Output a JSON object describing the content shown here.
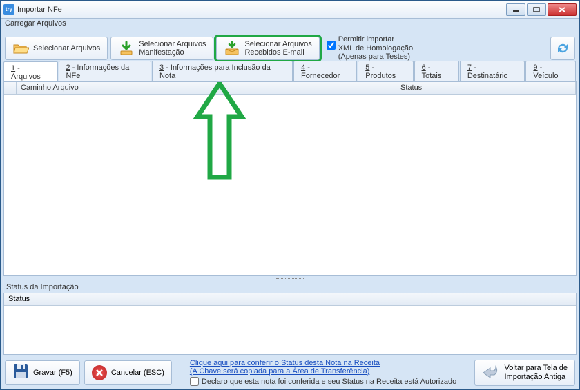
{
  "window": {
    "app_icon_text": "try",
    "title": "Importar NFe"
  },
  "menubar": {
    "item1": "Carregar Arquivos"
  },
  "toolbar": {
    "btn1": "Selecionar Arquivos",
    "btn2_line1": "Selecionar Arquivos",
    "btn2_line2": "Manifestação",
    "btn3_line1": "Selecionar Arquivos",
    "btn3_line2": "Recebidos E-mail",
    "permitir_line1": "Permitir importar",
    "permitir_line2": "XML de Homologação",
    "permitir_line3": "(Apenas para Testes)"
  },
  "tabs": {
    "t1_num": "1",
    "t1_lbl": " - Arquivos",
    "t2_num": "2",
    "t2_lbl": " - Informações da NFe",
    "t3_num": "3",
    "t3_lbl": " - Informações para Inclusão da Nota",
    "t4_num": "4",
    "t4_lbl": " - Fornecedor",
    "t5_num": "5",
    "t5_lbl": " - Produtos",
    "t6_num": "6",
    "t6_lbl": " - Totais",
    "t7_num": "7",
    "t7_lbl": " - Destinatário",
    "t9_num": "9",
    "t9_lbl": " - Veículo"
  },
  "grid": {
    "col0": "",
    "col1": "Caminho Arquivo",
    "col2": "Status"
  },
  "status_section": {
    "label": "Status da Importação",
    "col": "Status"
  },
  "footer": {
    "gravar": "Gravar (F5)",
    "cancelar": "Cancelar (ESC)",
    "link1": "Clique aqui para conferir o Status desta Nota na Receita ",
    "link2": "(A Chave será copiada para a Área de Transferência)",
    "declaro": "Declaro que esta nota foi conferida e seu Status na Receita está Autorizado",
    "voltar_line1": "Voltar para Tela de",
    "voltar_line2": "Importação Antiga"
  },
  "annotation": {
    "arrow_color": "#20a845"
  }
}
